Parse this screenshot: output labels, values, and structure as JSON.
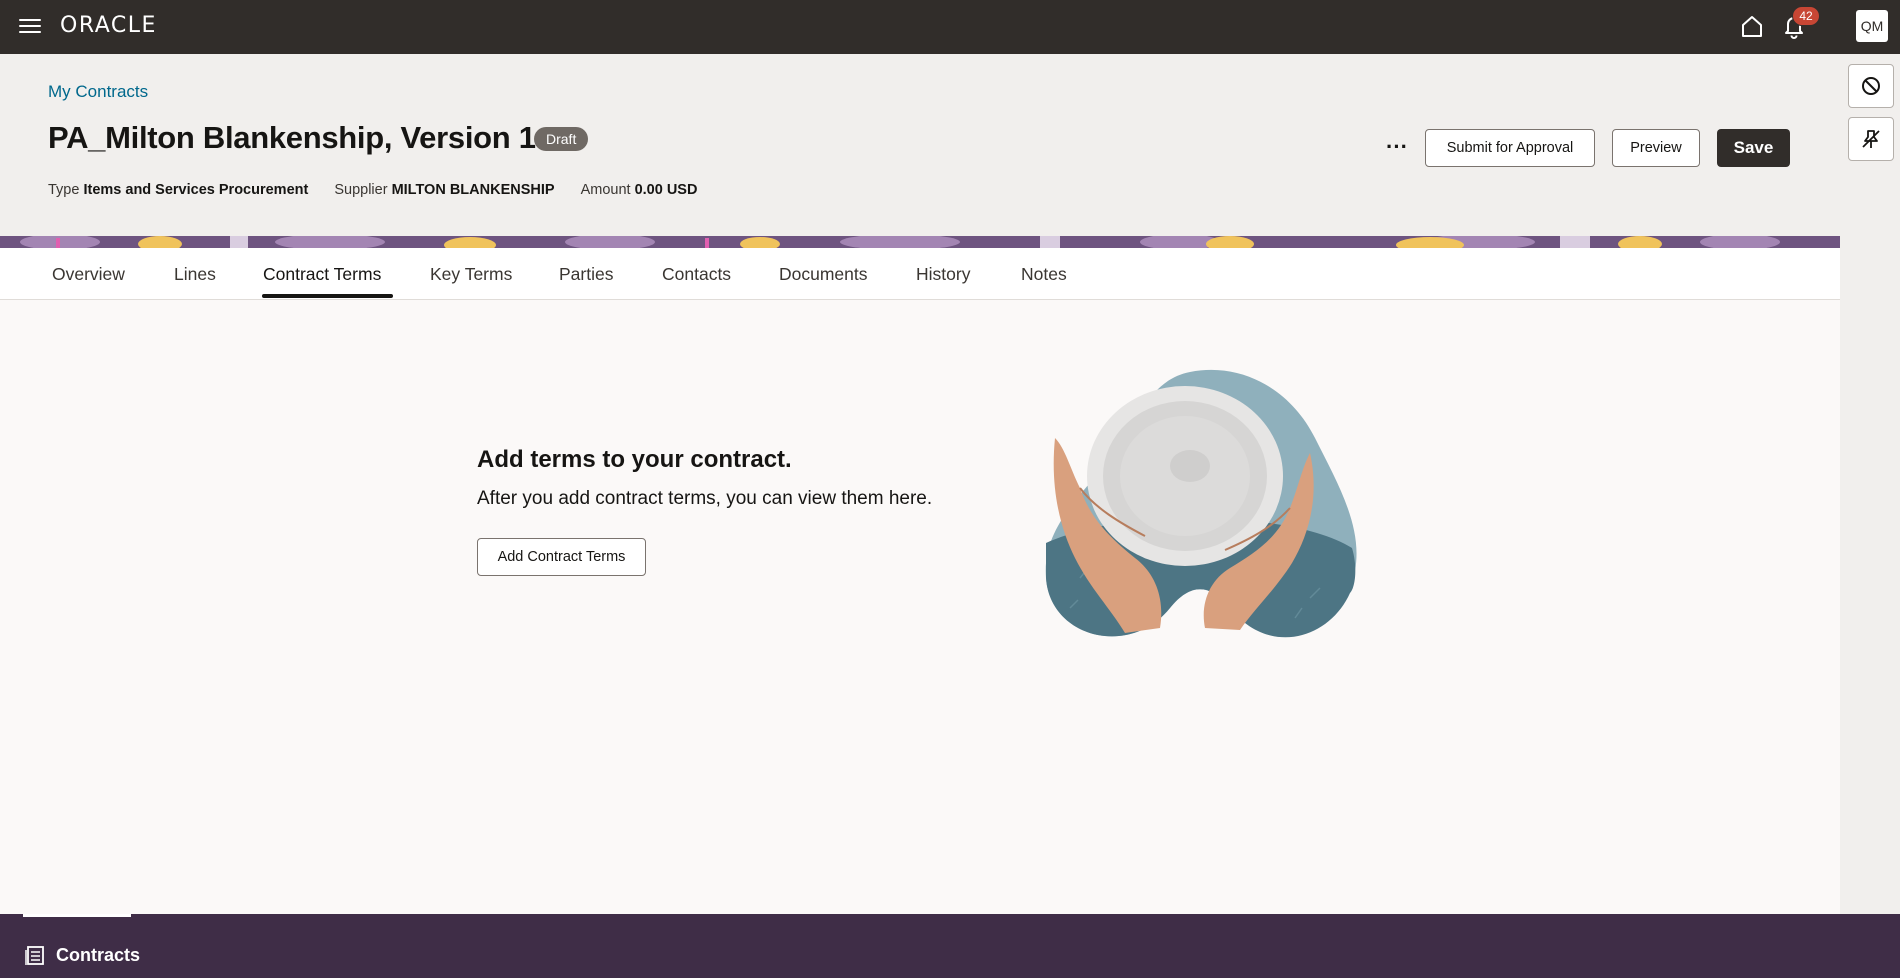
{
  "topbar": {
    "brand": "ORACLE",
    "notification_count": "42",
    "avatar_initials": "QM"
  },
  "header": {
    "breadcrumb": "My Contracts",
    "title": "PA_Milton Blankenship, Version 1",
    "status": "Draft",
    "meta": {
      "type_label": "Type",
      "type_value": "Items and Services Procurement",
      "supplier_label": "Supplier",
      "supplier_value": "MILTON BLANKENSHIP",
      "amount_label": "Amount",
      "amount_value": "0.00 USD"
    },
    "more_label": "···",
    "submit_label": "Submit for Approval",
    "preview_label": "Preview",
    "save_label": "Save"
  },
  "tabs": [
    {
      "label": "Overview"
    },
    {
      "label": "Lines"
    },
    {
      "label": "Contract Terms"
    },
    {
      "label": "Key Terms"
    },
    {
      "label": "Parties"
    },
    {
      "label": "Contacts"
    },
    {
      "label": "Documents"
    },
    {
      "label": "History"
    },
    {
      "label": "Notes"
    }
  ],
  "active_tab": "Contract Terms",
  "empty_state": {
    "title": "Add terms to your contract.",
    "description": "After you add contract terms, you can view them here.",
    "button_label": "Add Contract Terms"
  },
  "bottom_bar": {
    "label": "Contracts"
  },
  "colors": {
    "topbar": "#312d2a",
    "accent_link": "#00688c",
    "badge": "#c74634",
    "bottom_bar": "#3f2d47"
  },
  "icons": [
    "hamburger-icon",
    "home-icon",
    "bell-icon",
    "cancel-icon",
    "unpin-icon",
    "document-icon"
  ]
}
